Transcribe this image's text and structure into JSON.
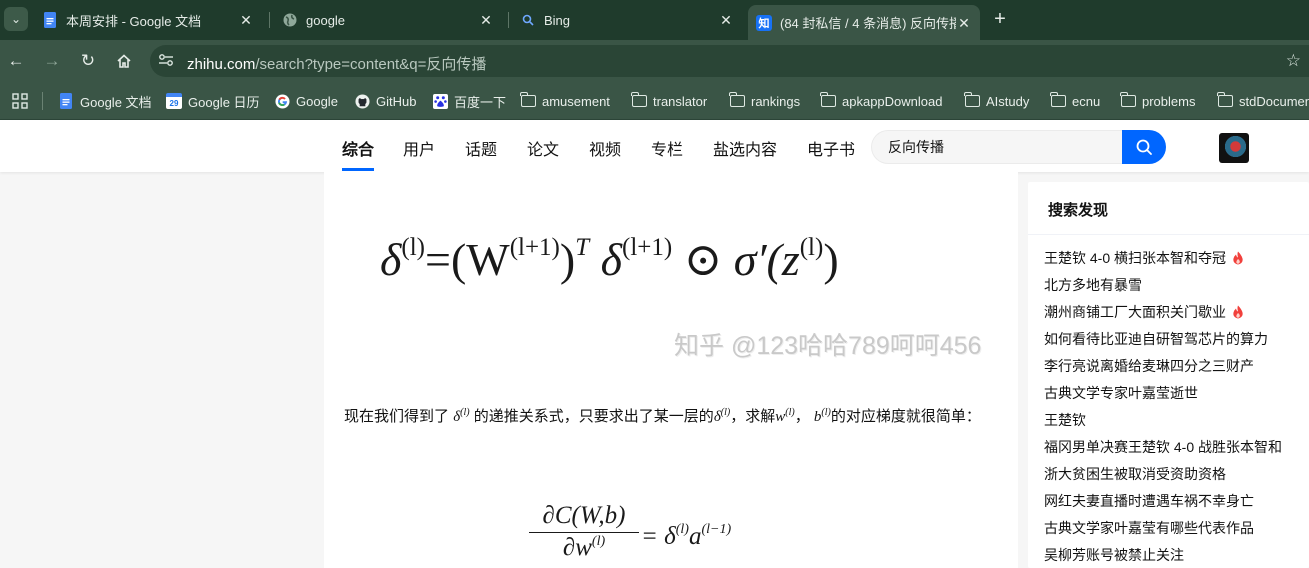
{
  "browser": {
    "tabs": [
      {
        "title": "本周安排 - Google 文档",
        "icon": "google-docs-icon"
      },
      {
        "title": "google",
        "icon": "globe-icon"
      },
      {
        "title": "Bing",
        "icon": "search-icon"
      },
      {
        "title": "(84 封私信 / 4 条消息) 反向传播",
        "icon": "zhihu-icon",
        "favicon_text": "知",
        "active": true
      }
    ],
    "url_host": "zhihu.com",
    "url_path": "/search?type=content&q=反向传播",
    "bookmarks": [
      {
        "label": "Google 文档",
        "icon": "google-docs-icon"
      },
      {
        "label": "Google 日历",
        "icon": "google-calendar-icon",
        "icon_text": "29"
      },
      {
        "label": "Google",
        "icon": "google-icon"
      },
      {
        "label": "GitHub",
        "icon": "github-icon"
      },
      {
        "label": "百度一下",
        "icon": "baidu-icon"
      },
      {
        "label": "amusement",
        "icon": "folder-icon"
      },
      {
        "label": "translator",
        "icon": "folder-icon"
      },
      {
        "label": "rankings",
        "icon": "folder-icon"
      },
      {
        "label": "apkappDownload",
        "icon": "folder-icon"
      },
      {
        "label": "AIstudy",
        "icon": "folder-icon"
      },
      {
        "label": "ecnu",
        "icon": "folder-icon"
      },
      {
        "label": "problems",
        "icon": "folder-icon"
      },
      {
        "label": "stdDocumen",
        "icon": "folder-icon"
      }
    ]
  },
  "zhihu": {
    "nav_tabs": [
      "综合",
      "用户",
      "话题",
      "论文",
      "视频",
      "专栏",
      "盐选内容",
      "电子书"
    ],
    "active_tab": "综合",
    "search_value": "反向传播",
    "colors": {
      "brand_blue": "#0066ff",
      "hot_red": "#f1403c"
    },
    "article": {
      "watermark": "知乎 @123哈哈789呵呵456",
      "para_1": "现在我们得到了",
      "para_2": "的递推关系式，只要求出了某一层的",
      "para_3": "，求解",
      "para_4": "，",
      "para_5": "的对应梯度就很简单：",
      "formula_1": {
        "lhs": "δ",
        "sup_l": "(l)",
        "eq": "=(W",
        "sup_l1": "(l+1)",
        "close": ")",
        "sup_T": "T",
        "delta": "δ",
        "sup_l1b": "(l+1)",
        "odot": "⊙",
        "sigma": "σ′(z",
        "sup_l2": "(l)",
        "end": ")"
      },
      "formula_2": {
        "num": "∂C(W,b)",
        "den": "∂w",
        "den_sup": "(l)",
        "rhs": "= δ",
        "rhs_sup": "(l)",
        "a": "a",
        "a_sup": "(l−1)"
      }
    },
    "sidebar": {
      "title": "搜索发现",
      "items": [
        {
          "text": "王楚钦 4-0 横扫张本智和夺冠",
          "hot": true
        },
        {
          "text": "北方多地有暴雪",
          "hot": false
        },
        {
          "text": "潮州商铺工厂大面积关门歇业",
          "hot": true
        },
        {
          "text": "如何看待比亚迪自研智驾芯片的算力",
          "hot": false
        },
        {
          "text": "李行亮说离婚给麦琳四分之三财产",
          "hot": false
        },
        {
          "text": "古典文学专家叶嘉莹逝世",
          "hot": false
        },
        {
          "text": "王楚钦",
          "hot": false
        },
        {
          "text": "福冈男单决赛王楚钦 4-0 战胜张本智和",
          "hot": false
        },
        {
          "text": "浙大贫困生被取消受资助资格",
          "hot": false
        },
        {
          "text": "网红夫妻直播时遭遇车祸不幸身亡",
          "hot": false
        },
        {
          "text": "古典文学家叶嘉莹有哪些代表作品",
          "hot": false
        },
        {
          "text": "吴柳芳账号被禁止关注",
          "hot": false
        }
      ]
    }
  }
}
